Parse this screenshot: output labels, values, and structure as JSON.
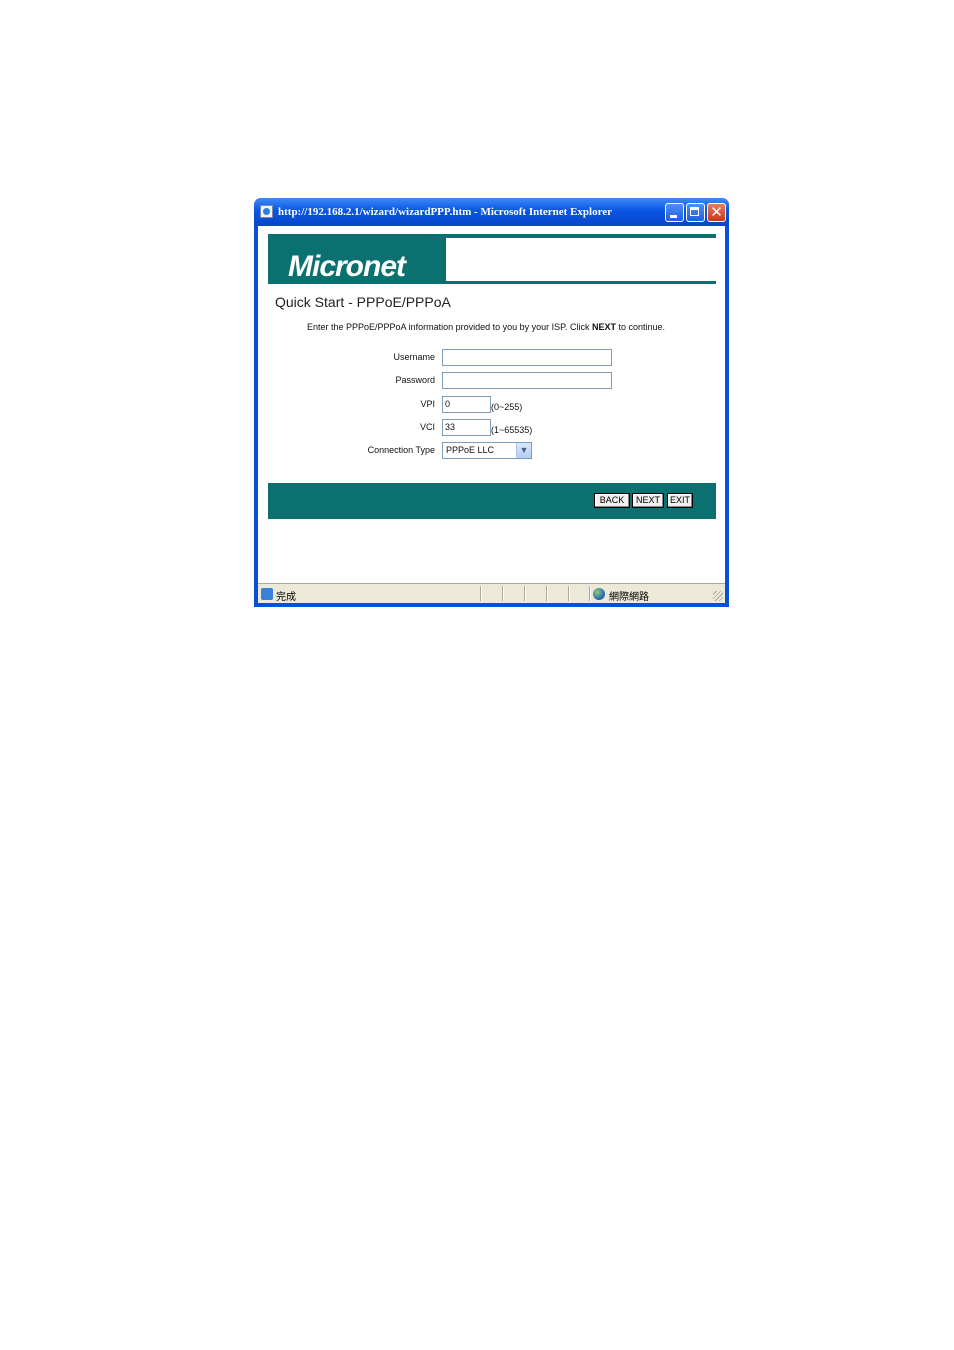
{
  "window": {
    "title": "http://192.168.2.1/wizard/wizardPPP.htm - Microsoft Internet Explorer",
    "close_glyph": "✕"
  },
  "brand": {
    "logo_text": "Micronet",
    "accent_color": "#0a7170"
  },
  "page": {
    "title": "Quick Start - PPPoE/PPPoA",
    "instruction_pre": "Enter the PPPoE/PPPoA information provided to you by your ISP. Click ",
    "instruction_bold": "NEXT",
    "instruction_post": " to continue."
  },
  "form": {
    "username": {
      "label": "Username",
      "value": ""
    },
    "password": {
      "label": "Password",
      "value": ""
    },
    "vpi": {
      "label": "VPI",
      "value": "0",
      "hint": "(0~255)"
    },
    "vci": {
      "label": "VCI",
      "value": "33",
      "hint": "(1~65535)"
    },
    "connection_type": {
      "label": "Connection Type",
      "value": "PPPoE LLC"
    }
  },
  "buttons": {
    "back": "BACK",
    "next": "NEXT",
    "exit": "EXIT"
  },
  "statusbar": {
    "status": "完成",
    "zone": "網際網路"
  }
}
